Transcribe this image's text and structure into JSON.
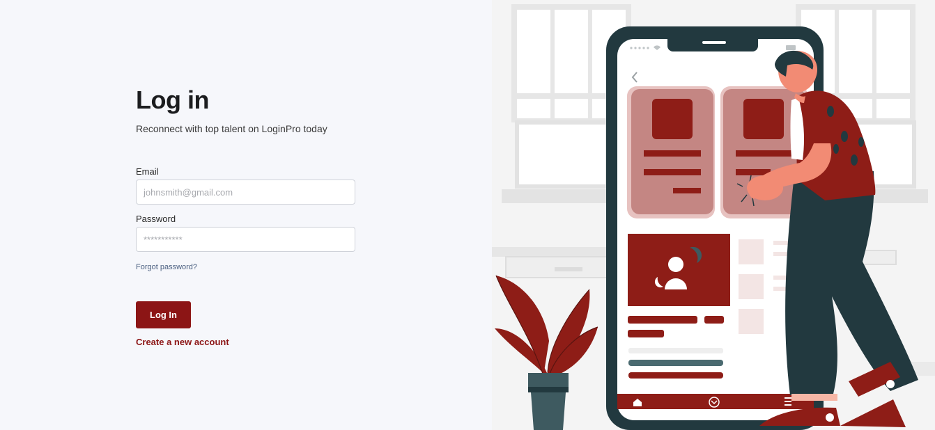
{
  "login": {
    "title": "Log in",
    "subtitle": "Reconnect with top talent on LoginPro today",
    "email_label": "Email",
    "email_placeholder": "johnsmith@gmail.com",
    "password_label": "Password",
    "password_placeholder": "***********",
    "forgot_link": "Forgot password?",
    "login_button": "Log In",
    "create_link": "Create a new account"
  },
  "colors": {
    "accent": "#8c1515",
    "background": "#f6f7fb",
    "illustration_dark": "#22393f",
    "illustration_red": "#8e1d17",
    "link_blue": "#4a5f80"
  },
  "icons": [
    "back-arrow-icon",
    "home-icon",
    "chevron-down-circle-icon",
    "menu-icon",
    "wifi-icon",
    "battery-icon",
    "user-avatar-icon"
  ]
}
